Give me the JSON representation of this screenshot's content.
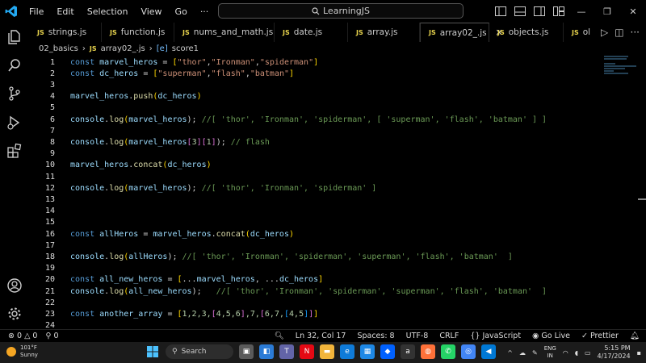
{
  "menu": [
    "File",
    "Edit",
    "Selection",
    "View",
    "Go",
    "···"
  ],
  "search_title": "LearningJS",
  "tabs": [
    {
      "icon": "JS",
      "label": "strings.js"
    },
    {
      "icon": "JS",
      "label": "function.js"
    },
    {
      "icon": "JS",
      "label": "nums_and_math.js"
    },
    {
      "icon": "JS",
      "label": "date.js"
    },
    {
      "icon": "JS",
      "label": "array.js"
    },
    {
      "icon": "JS",
      "label": "array02_.js"
    },
    {
      "icon": "JS",
      "label": "objects.js"
    },
    {
      "icon": "JS",
      "label": "ol"
    }
  ],
  "breadcrumb": {
    "folder": "02_basics",
    "file": "array02_.js",
    "symbol": "score1"
  },
  "line_numbers": [
    "1",
    "2",
    "3",
    "4",
    "5",
    "6",
    "7",
    "8",
    "9",
    "10",
    "11",
    "12",
    "13",
    "14",
    "15",
    "16",
    "17",
    "18",
    "19",
    "20",
    "21",
    "22",
    "23",
    "24"
  ],
  "code": {
    "l1": [
      "const",
      "marvel_heros",
      " = ",
      "[",
      "\"thor\"",
      ",",
      "\"Ironman\"",
      ",",
      "\"spiderman\"",
      "]"
    ],
    "l2": [
      "const",
      "dc_heros",
      " = ",
      "[",
      "\"superman\"",
      ",",
      "\"flash\"",
      ",",
      "\"batman\"",
      "]"
    ],
    "l4": [
      "marvel_heros",
      ".",
      "push",
      "(",
      "dc_heros",
      ")"
    ],
    "l6": [
      "console",
      ".",
      "log",
      "(",
      "marvel_heros",
      "); ",
      "//[ 'thor', 'Ironman', 'spiderman', [ 'superman', 'flash', 'batman' ] ]"
    ],
    "l8": [
      "console",
      ".",
      "log",
      "(",
      "marvel_heros",
      "[",
      "3",
      "][",
      "1",
      "]",
      "); ",
      "// flash"
    ],
    "l10": [
      "marvel_heros",
      ".",
      "concat",
      "(",
      "dc_heros",
      ")"
    ],
    "l12": [
      "console",
      ".",
      "log",
      "(",
      "marvel_heros",
      "); ",
      "//[ 'thor', 'Ironman', 'spiderman' ]"
    ],
    "l16": [
      "const",
      "allHeros",
      " = ",
      "marvel_heros",
      ".",
      "concat",
      "(",
      "dc_heros",
      ")"
    ],
    "l18": [
      "console",
      ".",
      "log",
      "(",
      "allHeros",
      "); ",
      "//[ 'thor', 'Ironman', 'spiderman', 'superman', 'flash', 'batman'  ]"
    ],
    "l20": [
      "const",
      "all_new_heros",
      " = ",
      "[",
      "...",
      "marvel_heros",
      ", ...",
      "dc_heros",
      "]"
    ],
    "l21": [
      "console",
      ".",
      "log",
      "(",
      "all_new_heros",
      ");   ",
      "//[ 'thor', 'Ironman', 'spiderman', 'superman', 'flash', 'batman'  ]"
    ],
    "l23": [
      "const",
      "another_array",
      " = ",
      "[",
      "1,2,3,",
      "[",
      "4,5,6",
      "]",
      ",7,",
      "[",
      "6,7,",
      "[",
      "4,5",
      "]",
      "]",
      "]"
    ]
  },
  "status": {
    "errors": "0",
    "warnings": "0",
    "ports": "0",
    "position": "Ln 32, Col 17",
    "spaces": "Spaces: 8",
    "encoding": "UTF-8",
    "eol": "CRLF",
    "language": "JavaScript",
    "golive": "Go Live",
    "prettier": "Prettier"
  },
  "taskbar": {
    "temp": "101°F",
    "weather": "Sunny",
    "search": "Search",
    "lang1": "ENG",
    "lang2": "IN",
    "time": "5:15 PM",
    "date": "4/17/2024"
  },
  "colors": {
    "accent": "#569cd6",
    "js_icon": "#e8d44d",
    "comment": "#6a9955",
    "string": "#ce9178"
  }
}
